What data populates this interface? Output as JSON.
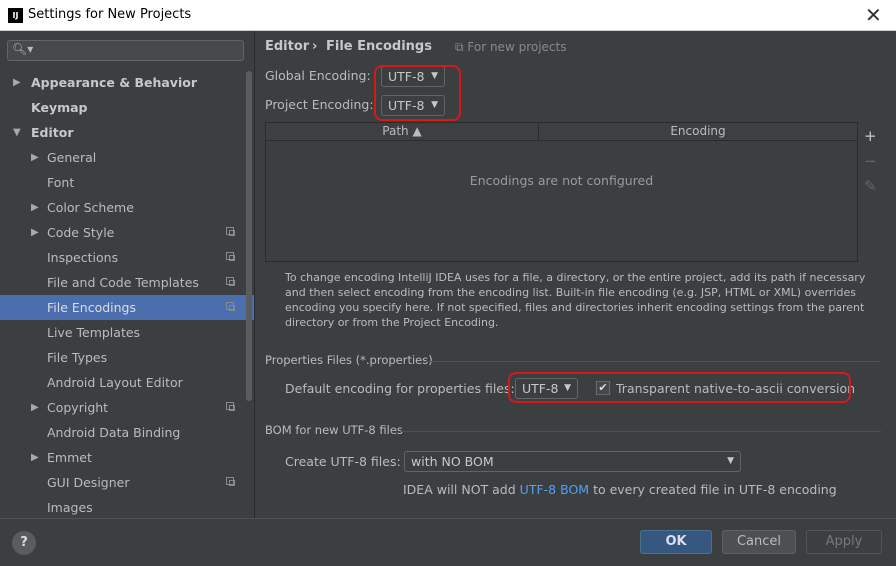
{
  "window": {
    "title": "Settings for New Projects",
    "app_icon": "IJ"
  },
  "search": {
    "placeholder": "",
    "value": ""
  },
  "sidebar": {
    "items": [
      {
        "label": "Appearance & Behavior",
        "bold": true,
        "arrow": "▶"
      },
      {
        "label": "Keymap",
        "bold": true,
        "arrow": ""
      },
      {
        "label": "Editor",
        "bold": true,
        "arrow": "▼"
      },
      {
        "label": "General",
        "arrow": "▶"
      },
      {
        "label": "Font",
        "arrow": ""
      },
      {
        "label": "Color Scheme",
        "arrow": "▶"
      },
      {
        "label": "Code Style",
        "arrow": "▶",
        "project": true
      },
      {
        "label": "Inspections",
        "arrow": "",
        "project": true
      },
      {
        "label": "File and Code Templates",
        "arrow": "",
        "project": true
      },
      {
        "label": "File Encodings",
        "arrow": "",
        "project": true,
        "selected": true
      },
      {
        "label": "Live Templates",
        "arrow": ""
      },
      {
        "label": "File Types",
        "arrow": ""
      },
      {
        "label": "Android Layout Editor",
        "arrow": ""
      },
      {
        "label": "Copyright",
        "arrow": "▶",
        "project": true
      },
      {
        "label": "Android Data Binding",
        "arrow": ""
      },
      {
        "label": "Emmet",
        "arrow": "▶"
      },
      {
        "label": "GUI Designer",
        "arrow": "",
        "project": true
      },
      {
        "label": "Images",
        "arrow": ""
      }
    ]
  },
  "breadcrumb": {
    "parent": "Editor",
    "separator": "›",
    "current": "File Encodings",
    "note": "For new projects"
  },
  "global_encoding": {
    "label": "Global Encoding:",
    "value": "UTF-8"
  },
  "project_encoding": {
    "label": "Project Encoding:",
    "value": "UTF-8"
  },
  "table": {
    "columns": [
      "Path",
      "Encoding"
    ],
    "sort_indicator": "▲",
    "empty_text": "Encodings are not configured"
  },
  "toolbar": {
    "add": "+",
    "remove": "−",
    "edit": "✎"
  },
  "description": "To change encoding IntelliJ IDEA uses for a file, a directory, or the entire project, add its path if necessary and then select encoding from the encoding list. Built-in file encoding (e.g. JSP, HTML or XML) overrides encoding you specify here. If not specified, files and directories inherit encoding settings from the parent directory or from the Project Encoding.",
  "properties": {
    "section_title": "Properties Files (*.properties)",
    "default_label": "Default encoding for properties files:",
    "default_value": "UTF-8",
    "checkbox_label": "Transparent native-to-ascii conversion",
    "checkbox_mark": "✔"
  },
  "bom": {
    "section_title": "BOM for new UTF-8 files",
    "create_label": "Create UTF-8 files:",
    "create_value": "with NO BOM",
    "note_before": "IDEA will NOT add",
    "note_link": "UTF-8 BOM",
    "note_after": "to every created file in UTF-8 encoding"
  },
  "footer": {
    "help": "?",
    "ok": "OK",
    "cancel": "Cancel",
    "apply": "Apply"
  },
  "colors": {
    "accent": "#4b6eaf",
    "highlight_box": "#d61919",
    "link": "#589df6",
    "background": "#3c3f41"
  }
}
